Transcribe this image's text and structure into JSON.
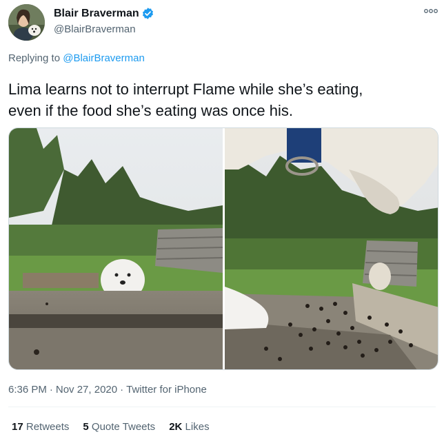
{
  "author": {
    "display_name": "Blair Braverman",
    "handle": "@BlairBraverman",
    "verified": true,
    "avatar_icon": "profile-photo-icon"
  },
  "more_icon": "more-options-icon",
  "reply": {
    "prefix": "Replying to",
    "handle": "@BlairBraverman"
  },
  "tweet": {
    "line1": "Lima learns not to interrupt Flame while she’s eating,",
    "line2": "even if the food she’s eating was once his."
  },
  "media": [
    {
      "alt_icon": "photo-dog-behind-table"
    },
    {
      "alt_icon": "photo-dog-eating-kibble"
    }
  ],
  "meta": {
    "time": "6:36 PM",
    "dot1": "·",
    "date": "Nov 27, 2020",
    "dot2": "·",
    "source": "Twitter for iPhone"
  },
  "stats": {
    "retweets_count": "17",
    "retweets_label": "Retweets",
    "quotes_count": "5",
    "quotes_label": "Quote Tweets",
    "likes_count": "2K",
    "likes_label": "Likes"
  },
  "colors": {
    "link": "#1d9bf0",
    "secondary_text": "#536471",
    "primary_text": "#0f1419",
    "divider": "#eff3f4"
  }
}
